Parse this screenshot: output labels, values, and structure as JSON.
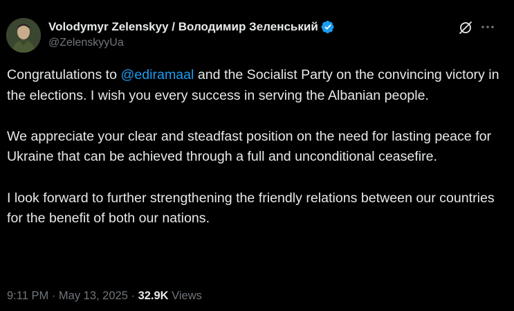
{
  "author": {
    "display_name": "Volodymyr Zelenskyy / Володимир Зеленський",
    "handle": "@ZelenskyyUa",
    "verified_color": "#1d9bf0"
  },
  "tweet": {
    "paragraph1_before": "Congratulations to ",
    "mention": "@ediramaal",
    "paragraph1_after": " and the Socialist Party on the convincing victory in the elections. I wish you every success in serving the Albanian people.",
    "paragraph2": "We appreciate your clear and steadfast position on the need for lasting peace for Ukraine that can be achieved through a full and unconditional ceasefire.",
    "paragraph3": "I look forward to further strengthening the friendly relations between our countries for the benefit of both our nations."
  },
  "meta": {
    "time": "9:11 PM",
    "separator": " · ",
    "date": "May 13, 2025",
    "views_count": "32.9K",
    "views_label": " Views"
  },
  "colors": {
    "background": "#000000",
    "text": "#e7e9ea",
    "secondary": "#71767b",
    "accent": "#1d9bf0"
  },
  "icons": {
    "verified": "verified-badge-icon",
    "grok": "grok-icon",
    "more": "more-dots-icon"
  }
}
